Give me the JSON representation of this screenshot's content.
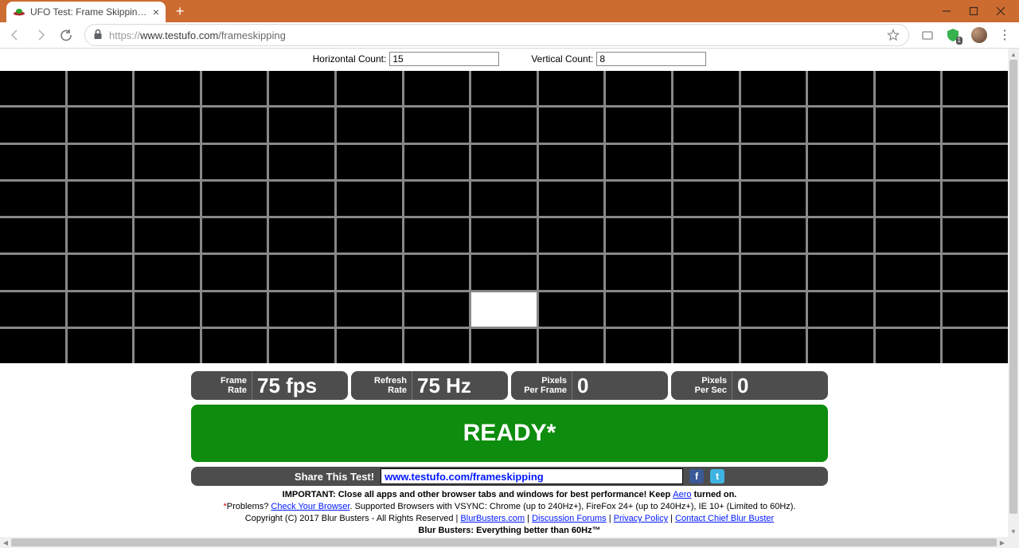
{
  "browser": {
    "tabTitle": "UFO Test: Frame Skipping Check",
    "urlScheme": "https://",
    "urlHost": "www.testufo.com",
    "urlPath": "/frameskipping"
  },
  "controls": {
    "horizontalLabel": "Horizontal Count:",
    "horizontalValue": "15",
    "verticalLabel": "Vertical Count:",
    "verticalValue": "8"
  },
  "grid": {
    "cols": 15,
    "rows": 8,
    "activeCol": 7,
    "activeRow": 6
  },
  "stats": [
    {
      "label1": "Frame",
      "label2": "Rate",
      "value": "75 fps"
    },
    {
      "label1": "Refresh",
      "label2": "Rate",
      "value": "75 Hz"
    },
    {
      "label1": "Pixels",
      "label2": "Per Frame",
      "value": "0"
    },
    {
      "label1": "Pixels",
      "label2": "Per Sec",
      "value": "0"
    }
  ],
  "ready": "READY*",
  "share": {
    "label": "Share This Test!",
    "url": "www.testufo.com/frameskipping"
  },
  "footer": {
    "importantPrefix": "IMPORTANT: Close all apps and other browser tabs and windows for best performance! Keep ",
    "aeroLink": "Aero",
    "importantSuffix": " turned on.",
    "problemsStar": "*",
    "problemsLabel": "Problems? ",
    "checkBrowser": "Check Your Browser",
    "supported": ". Supported Browsers with VSYNC: Chrome (up to 240Hz+), FireFox 24+ (up to 240Hz+), IE 10+ (Limited to 60Hz).",
    "copyright": "Copyright (C) 2017 Blur Busters - All Rights Reserved | ",
    "link1": "BlurBusters.com",
    "sep": " | ",
    "link2": "Discussion Forums",
    "link3": "Privacy Policy",
    "link4": "Contact Chief Blur Buster",
    "tagline": "Blur Busters: Everything better than 60Hz™"
  }
}
